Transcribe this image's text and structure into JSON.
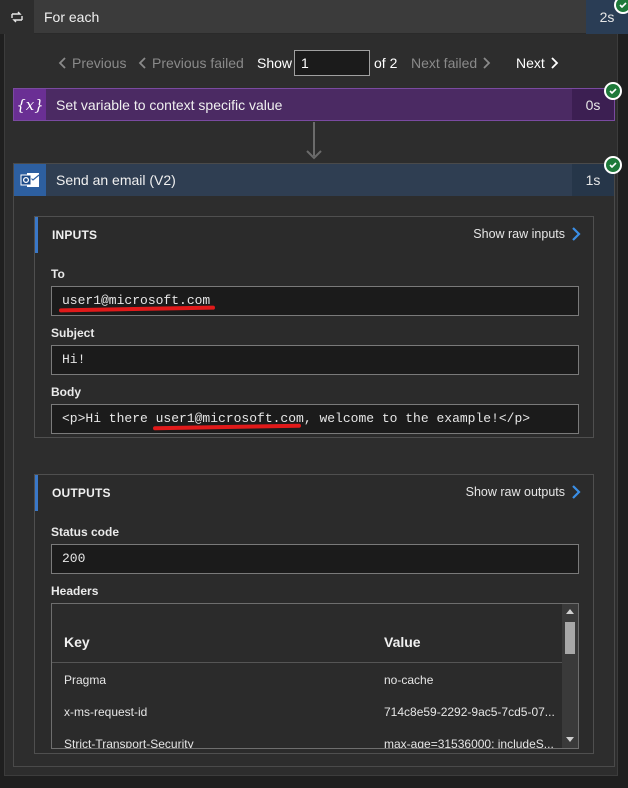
{
  "foreach": {
    "title": "For each",
    "duration": "2s"
  },
  "pager": {
    "previous": "Previous",
    "previous_failed": "Previous failed",
    "show_label": "Show",
    "current_value": "1",
    "of_total": "of 2",
    "next_failed": "Next failed",
    "next": "Next"
  },
  "set_variable": {
    "icon_text": "{x}",
    "title": "Set variable to context specific value",
    "duration": "0s"
  },
  "email_action": {
    "title": "Send an email (V2)",
    "duration": "1s"
  },
  "inputs": {
    "header": "INPUTS",
    "show_raw": "Show raw inputs",
    "to_label": "To",
    "to_value": "user1@microsoft.com",
    "subject_label": "Subject",
    "subject_value": "Hi!",
    "body_label": "Body",
    "body_value": "<p>Hi there user1@microsoft.com, welcome to the example!</p>"
  },
  "outputs": {
    "header": "OUTPUTS",
    "show_raw": "Show raw outputs",
    "status_label": "Status code",
    "status_value": "200",
    "headers_label": "Headers",
    "headers_table": {
      "key_col": "Key",
      "value_col": "Value",
      "rows": [
        {
          "key": "Pragma",
          "value": "no-cache"
        },
        {
          "key": "x-ms-request-id",
          "value": "714c8e59-2292-9ac5-7cd5-07..."
        },
        {
          "key": "Strict-Transport-Security",
          "value": "max-age=31536000; includeS..."
        }
      ]
    }
  },
  "colors": {
    "accent_blue": "#3a78c8",
    "set_variable_purple": "#6a2f94",
    "success_green": "#1e7a3a",
    "annotation_red": "#e11a1a"
  }
}
